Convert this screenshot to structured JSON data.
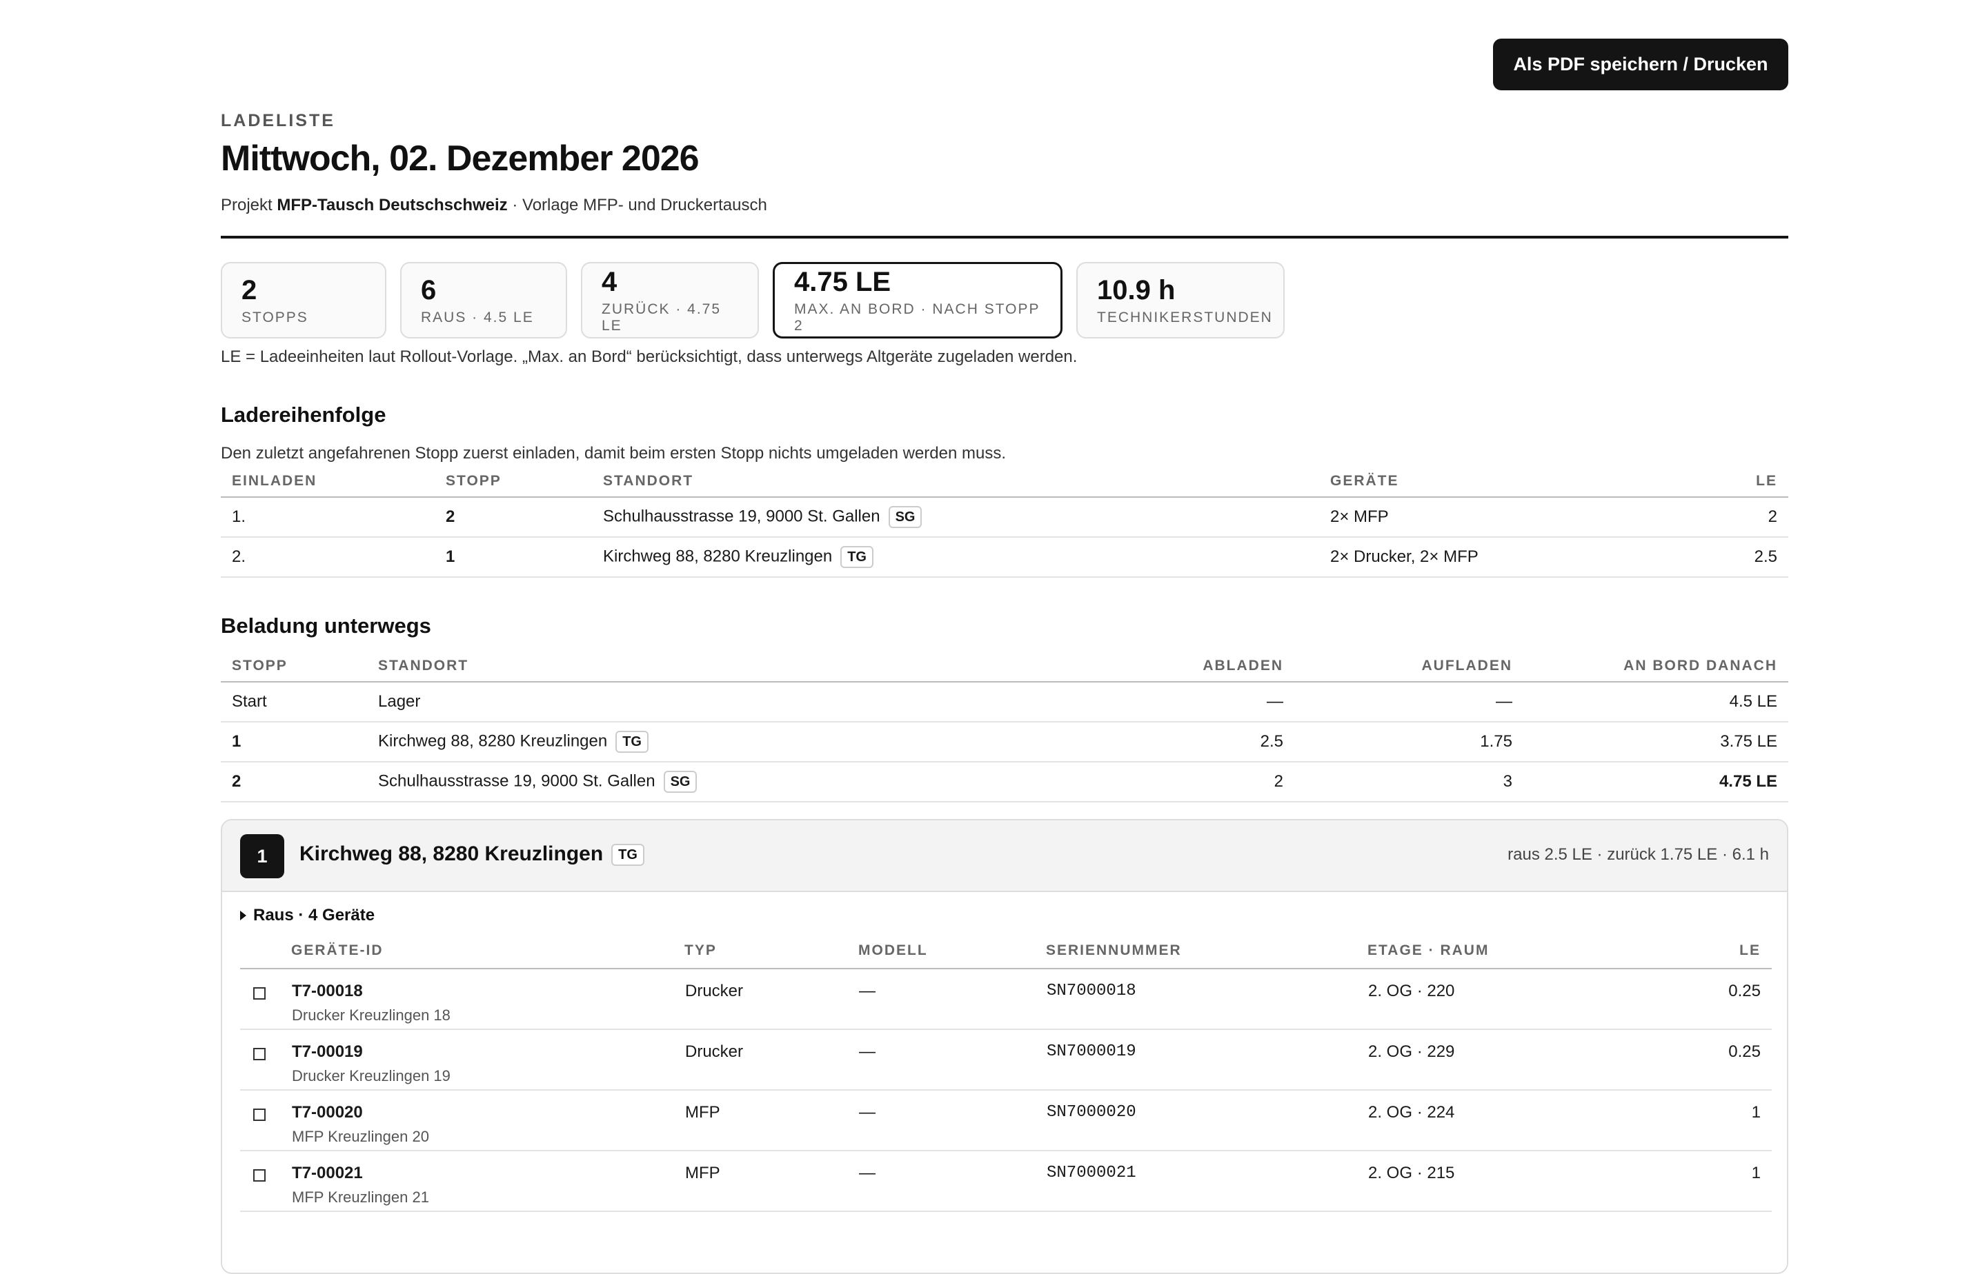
{
  "actions": {
    "print_label": "Als PDF speichern / Drucken"
  },
  "header": {
    "eyebrow": "LADELISTE",
    "title": "Mittwoch, 02. Dezember 2026",
    "project_prefix": "Projekt",
    "project_name": "MFP-Tausch Deutschschweiz",
    "template": "· Vorlage MFP- und Druckertausch"
  },
  "kpis": [
    {
      "value": "2",
      "label": "Stopps"
    },
    {
      "value": "6",
      "label": "Raus · 4.5 LE"
    },
    {
      "value": "4",
      "label": "Zurück · 4.75 LE"
    },
    {
      "value": "4.75 LE",
      "label": "Max. an Bord · nach Stopp 2"
    },
    {
      "value": "10.9 h",
      "label": "Technikerstunden"
    }
  ],
  "note": "LE = Ladeeinheiten laut Rollout-Vorlage. „Max. an Bord“ berücksichtigt, dass unterwegs Altgeräte zugeladen werden.",
  "loading_order": {
    "title": "Ladereihenfolge",
    "intro": "Den zuletzt angefahrenen Stopp zuerst einladen, damit beim ersten Stopp nichts umgeladen werden muss.",
    "columns": [
      "Einladen",
      "Stopp",
      "Standort",
      "Geräte",
      "LE"
    ],
    "rows": [
      {
        "order": "1.",
        "stop": "2",
        "location": "Schulhausstrasse 19, 9000 St. Gallen",
        "canton": "SG",
        "devices": "2× MFP",
        "le": "2"
      },
      {
        "order": "2.",
        "stop": "1",
        "location": "Kirchweg 88, 8280 Kreuzlingen",
        "canton": "TG",
        "devices": "2× Drucker, 2× MFP",
        "le": "2.5"
      }
    ]
  },
  "enroute": {
    "title": "Beladung unterwegs",
    "columns": [
      "Stopp",
      "Standort",
      "Abladen",
      "Aufladen",
      "An Bord danach"
    ],
    "rows": [
      {
        "stop": "Start",
        "location": "Lager",
        "canton": "",
        "unload": "—",
        "load": "—",
        "onboard": "4.5 LE"
      },
      {
        "stop": "1",
        "location": "Kirchweg 88, 8280 Kreuzlingen",
        "canton": "TG",
        "unload": "2.5",
        "load": "1.75",
        "onboard": "3.75 LE"
      },
      {
        "stop": "2",
        "location": "Schulhausstrasse 19, 9000 St. Gallen",
        "canton": "SG",
        "unload": "2",
        "load": "3",
        "onboard": "4.75 LE"
      }
    ]
  },
  "stop_card": {
    "number": "1",
    "title": "Kirchweg 88, 8280 Kreuzlingen",
    "canton": "TG",
    "meta": "raus 2.5 LE · zurück 1.75 LE · 6.1 h",
    "section_label": "Raus · 4 Geräte",
    "columns": [
      "Geräte-ID",
      "Typ",
      "Modell",
      "Seriennummer",
      "Etage · Raum",
      "LE"
    ],
    "devices": [
      {
        "id": "T7-00018",
        "name": "Drucker Kreuzlingen 18",
        "type": "Drucker",
        "model": "—",
        "serial": "SN7000018",
        "floor": "2. OG · 220",
        "le": "0.25"
      },
      {
        "id": "T7-00019",
        "name": "Drucker Kreuzlingen 19",
        "type": "Drucker",
        "model": "—",
        "serial": "SN7000019",
        "floor": "2. OG · 229",
        "le": "0.25"
      },
      {
        "id": "T7-00020",
        "name": "MFP Kreuzlingen 20",
        "type": "MFP",
        "model": "—",
        "serial": "SN7000020",
        "floor": "2. OG · 224",
        "le": "1"
      },
      {
        "id": "T7-00021",
        "name": "MFP Kreuzlingen 21",
        "type": "MFP",
        "model": "—",
        "serial": "SN7000021",
        "floor": "2. OG · 215",
        "le": "1"
      }
    ]
  }
}
